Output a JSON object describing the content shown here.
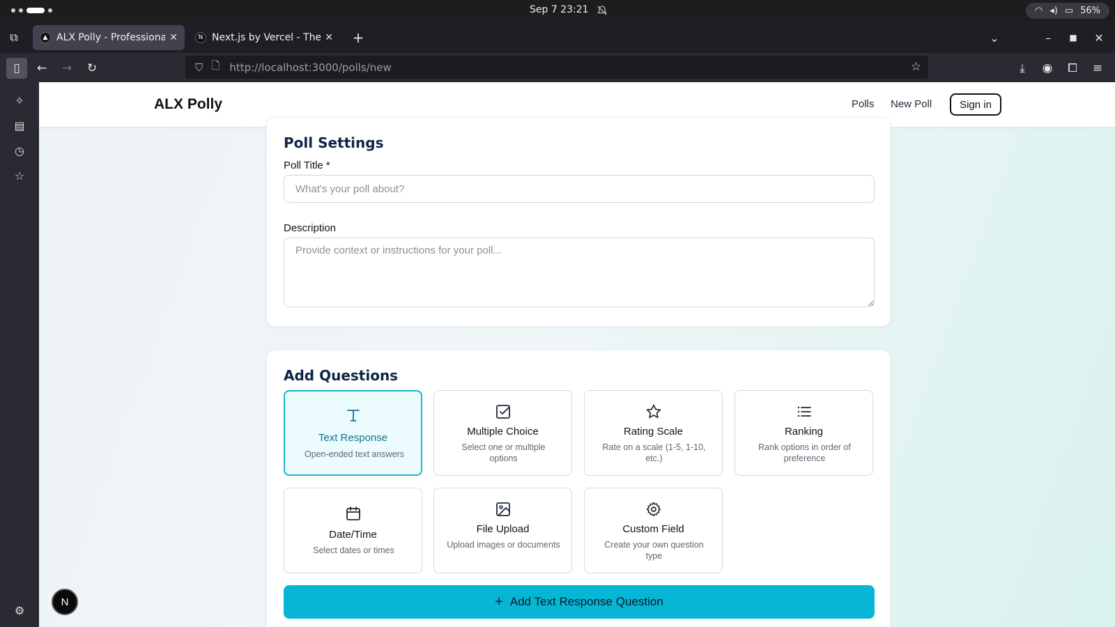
{
  "os": {
    "clock": "Sep 7  23:21",
    "battery": "56%"
  },
  "tabs": [
    {
      "label": "ALX Polly - Professional P",
      "favicon": "▲"
    },
    {
      "label": "Next.js by Vercel - The Re",
      "favicon": "N"
    }
  ],
  "toolbar": {
    "url": "http://localhost:3000/polls/new"
  },
  "header": {
    "brand": "ALX Polly",
    "nav": [
      "Polls",
      "New Poll"
    ],
    "signin": "Sign in"
  },
  "settings": {
    "title": "Poll Settings",
    "title_label": "Poll Title *",
    "title_placeholder": "What's your poll about?",
    "desc_label": "Description",
    "desc_placeholder": "Provide context or instructions for your poll..."
  },
  "questions": {
    "title": "Add Questions",
    "types": [
      {
        "title": "Text Response",
        "desc": "Open-ended text answers",
        "icon": "text-icon",
        "selected": true
      },
      {
        "title": "Multiple Choice",
        "desc": "Select one or multiple options",
        "icon": "checkbox-icon",
        "selected": false
      },
      {
        "title": "Rating Scale",
        "desc": "Rate on a scale (1-5, 1-10, etc.)",
        "icon": "star-icon",
        "selected": false
      },
      {
        "title": "Ranking",
        "desc": "Rank options in order of preference",
        "icon": "list-icon",
        "selected": false
      },
      {
        "title": "Date/Time",
        "desc": "Select dates or times",
        "icon": "calendar-icon",
        "selected": false
      },
      {
        "title": "File Upload",
        "desc": "Upload images or documents",
        "icon": "image-icon",
        "selected": false
      },
      {
        "title": "Custom Field",
        "desc": "Create your own question type",
        "icon": "gear-icon",
        "selected": false
      }
    ],
    "add_button": "Add Text Response Question"
  },
  "badge": "N",
  "colors": {
    "accent": "#06b6d4",
    "heading": "#0f2547",
    "selected_border": "#17b6d2"
  }
}
